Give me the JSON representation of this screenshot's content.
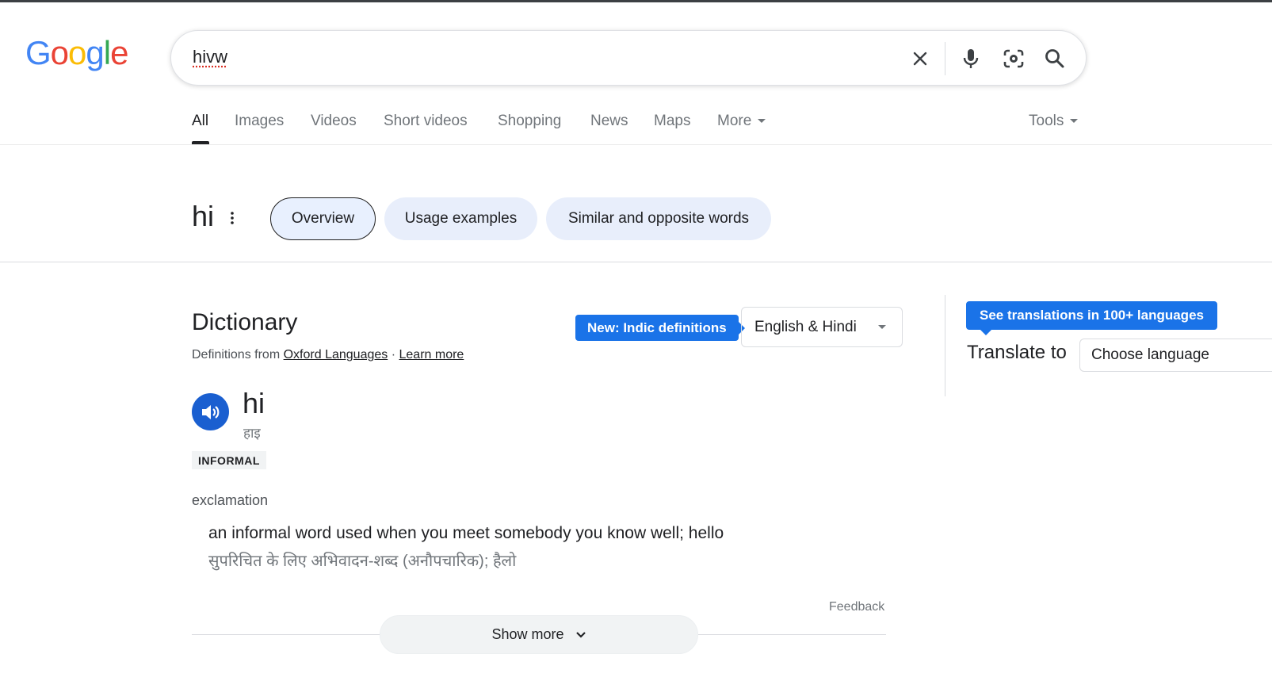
{
  "logo": {
    "letters": [
      "G",
      "o",
      "o",
      "g",
      "l",
      "e"
    ],
    "colors": [
      "#4285F4",
      "#EA4335",
      "#FBBC05",
      "#4285F4",
      "#34A853",
      "#EA4335"
    ]
  },
  "search": {
    "query": "hivw"
  },
  "icons": {
    "clear": "close-icon",
    "voice": "microphone-icon",
    "lens": "camera-lens-icon",
    "search": "search-icon"
  },
  "tabs": [
    "All",
    "Images",
    "Videos",
    "Short videos",
    "Shopping",
    "News",
    "Maps",
    "More"
  ],
  "tools_label": "Tools",
  "word_header": {
    "word": "hi",
    "chips": [
      "Overview",
      "Usage examples",
      "Similar and opposite words"
    ]
  },
  "dictionary": {
    "title": "Dictionary",
    "source_prefix": "Definitions from",
    "source_link": "Oxford Languages",
    "separator": "·",
    "learn_more": "Learn more",
    "new_badge": "New: Indic definitions",
    "language_pair": "English & Hindi",
    "headword": "hi",
    "phonetic": "हाइ",
    "register_label": "INFORMAL",
    "part_of_speech": "exclamation",
    "definition": "an informal word used when you meet somebody you know well; hello",
    "definition_hi": "सुपरिचित के लिए अभिवादन-शब्द (अनौपचारिक); हैलो",
    "feedback": "Feedback",
    "show_more": "Show more"
  },
  "translate": {
    "badge": "See translations in 100+ languages",
    "label": "Translate to",
    "select_placeholder": "Choose language"
  },
  "colors": {
    "accent": "#1a73e8",
    "speaker": "#1a5fd0",
    "chip_bg": "#e8eefb"
  }
}
